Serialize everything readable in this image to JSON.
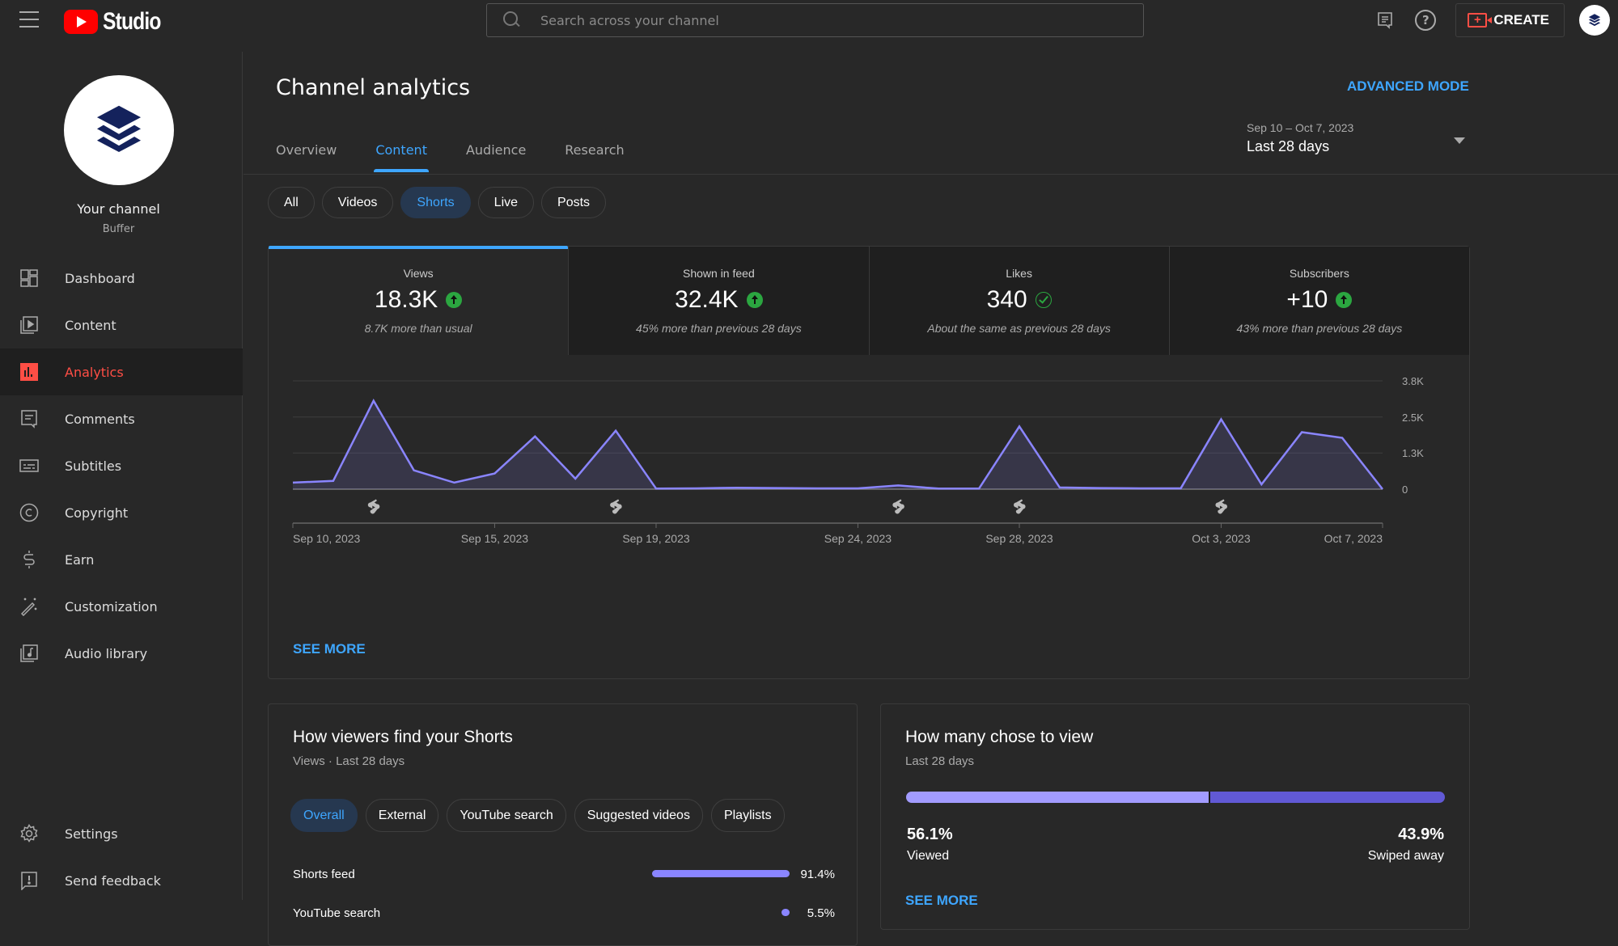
{
  "topbar": {
    "app_name": "Studio",
    "search_placeholder": "Search across your channel",
    "create_label": "CREATE"
  },
  "sidebar": {
    "channel_label": "Your channel",
    "channel_name": "Buffer",
    "items": [
      {
        "label": "Dashboard",
        "icon": "dashboard-icon"
      },
      {
        "label": "Content",
        "icon": "content-icon"
      },
      {
        "label": "Analytics",
        "icon": "analytics-icon",
        "active": true
      },
      {
        "label": "Comments",
        "icon": "comments-icon"
      },
      {
        "label": "Subtitles",
        "icon": "subtitles-icon"
      },
      {
        "label": "Copyright",
        "icon": "copyright-icon"
      },
      {
        "label": "Earn",
        "icon": "earn-icon"
      },
      {
        "label": "Customization",
        "icon": "customization-icon"
      },
      {
        "label": "Audio library",
        "icon": "audio-library-icon"
      }
    ],
    "bottom_items": [
      {
        "label": "Settings",
        "icon": "settings-icon"
      },
      {
        "label": "Send feedback",
        "icon": "feedback-icon"
      }
    ]
  },
  "page": {
    "title": "Channel analytics",
    "advanced_mode": "ADVANCED MODE",
    "tabs": [
      "Overview",
      "Content",
      "Audience",
      "Research"
    ],
    "active_tab": "Content",
    "date_range": {
      "dates": "Sep 10 – Oct 7, 2023",
      "label": "Last 28 days"
    },
    "content_chips": [
      "All",
      "Videos",
      "Shorts",
      "Live",
      "Posts"
    ],
    "selected_chip": "Shorts"
  },
  "metrics": [
    {
      "label": "Views",
      "value": "18.3K",
      "status": "up",
      "note": "8.7K more than usual",
      "selected": true
    },
    {
      "label": "Shown in feed",
      "value": "32.4K",
      "status": "up",
      "note": "45% more than previous 28 days"
    },
    {
      "label": "Likes",
      "value": "340",
      "status": "same",
      "note": "About the same as previous 28 days"
    },
    {
      "label": "Subscribers",
      "value": "+10",
      "status": "up",
      "note": "43% more than previous 28 days"
    }
  ],
  "chart_data": {
    "type": "area",
    "title": "Views",
    "xlabel": "",
    "ylabel": "",
    "x": [
      "Sep 10",
      "Sep 11",
      "Sep 12",
      "Sep 13",
      "Sep 14",
      "Sep 15",
      "Sep 16",
      "Sep 17",
      "Sep 18",
      "Sep 19",
      "Sep 20",
      "Sep 21",
      "Sep 22",
      "Sep 23",
      "Sep 24",
      "Sep 25",
      "Sep 26",
      "Sep 27",
      "Sep 28",
      "Sep 29",
      "Sep 30",
      "Oct 1",
      "Oct 2",
      "Oct 3",
      "Oct 4",
      "Oct 5",
      "Oct 6",
      "Oct 7"
    ],
    "series": [
      {
        "name": "Views",
        "color": "#8a85ff",
        "values": [
          230,
          290,
          3100,
          660,
          230,
          550,
          1850,
          370,
          2050,
          20,
          30,
          50,
          40,
          30,
          30,
          130,
          20,
          20,
          2200,
          60,
          40,
          30,
          30,
          2450,
          170,
          2000,
          1800,
          0
        ]
      }
    ],
    "x_tick_labels": [
      "Sep 10, 2023",
      "Sep 15, 2023",
      "Sep 19, 2023",
      "Sep 24, 2023",
      "Sep 28, 2023",
      "Oct 3, 2023",
      "Oct 7, 2023"
    ],
    "x_tick_index": [
      0,
      5,
      9,
      14,
      18,
      23,
      27
    ],
    "y_ticks": [
      0,
      1270,
      2530,
      3800
    ],
    "y_tick_labels": [
      "0",
      "1.3K",
      "2.5K",
      "3.8K"
    ],
    "ylim": [
      0,
      3800
    ],
    "y_axis_position": "right",
    "grid": true,
    "shorts_published_index": [
      2,
      8,
      15,
      18,
      23
    ]
  },
  "main_card": {
    "see_more": "SEE MORE"
  },
  "find_card": {
    "title": "How viewers find your Shorts",
    "subtitle": "Views · Last 28 days",
    "chips": [
      "Overall",
      "External",
      "YouTube search",
      "Suggested videos",
      "Playlists"
    ],
    "selected_chip": "Overall",
    "rows": [
      {
        "name": "Shorts feed",
        "percent": 91.4,
        "label": "91.4%"
      },
      {
        "name": "YouTube search",
        "percent": 5.5,
        "label": "5.5%"
      }
    ]
  },
  "view_card": {
    "title": "How many chose to view",
    "subtitle": "Last 28 days",
    "viewed_pct": 56.1,
    "viewed_label": "56.1%",
    "viewed_text": "Viewed",
    "swiped_pct": 43.9,
    "swiped_label": "43.9%",
    "swiped_text": "Swiped away",
    "see_more": "SEE MORE"
  }
}
